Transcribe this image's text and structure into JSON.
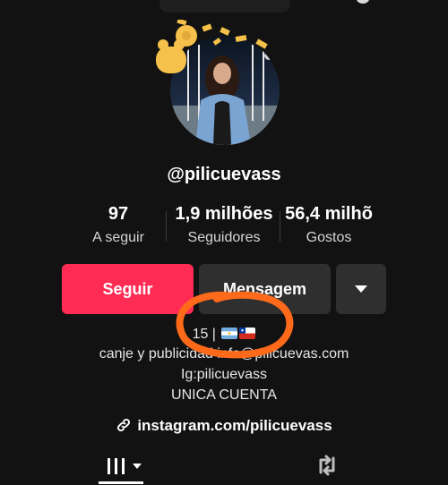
{
  "profile": {
    "username": "@pilicuevass"
  },
  "stats": {
    "following": {
      "value": "97",
      "label": "A seguir"
    },
    "followers": {
      "value": "1,9 milhões",
      "label": "Seguidores"
    },
    "likes": {
      "value": "56,4 milhõ",
      "label": "Gostos"
    }
  },
  "actions": {
    "follow_label": "Seguir",
    "message_label": "Mensagem",
    "more_icon": "caret-down-icon"
  },
  "bio": {
    "line1": "15 |",
    "line1_flags": [
      "flag-argentina",
      "flag-chile"
    ],
    "line2": "canje y publicidad info@pilicuevas.com",
    "line3": "Ig:pilicuevass",
    "line4": "UNICA CUENTA"
  },
  "link": {
    "text": "instagram.com/pilicuevass",
    "icon": "link-icon"
  },
  "tabs": {
    "videos_icon": "grid-icon",
    "reposts_icon": "repost-icon"
  },
  "colors": {
    "background": "#121212",
    "follow_button": "#fe2c55",
    "secondary_button": "#2f2f2f",
    "annotation": "#ff6a1a"
  }
}
